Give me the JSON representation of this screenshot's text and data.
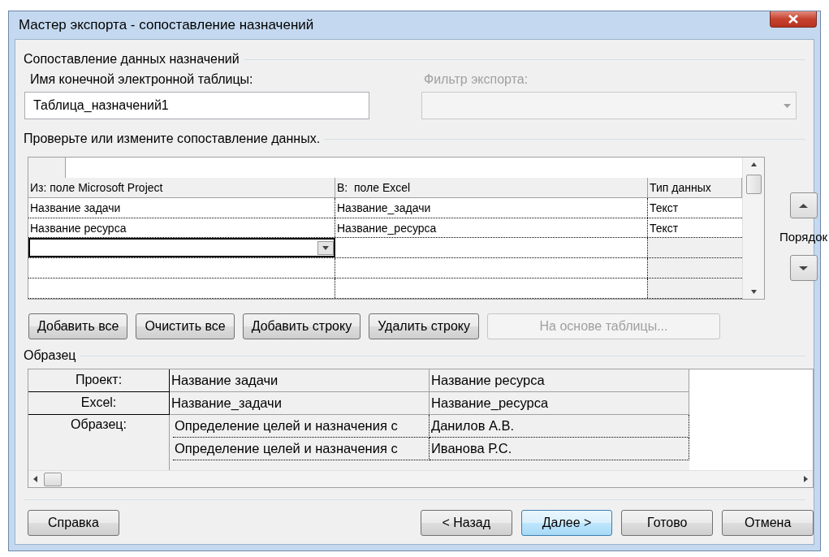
{
  "window": {
    "title": "Мастер экспорта - сопоставление назначений"
  },
  "mapping_group": {
    "title": "Сопоставление данных назначений",
    "dest_label": "Имя конечной электронной таблицы:",
    "dest_value": "Таблица_назначений1",
    "filter_label": "Фильтр экспорта:",
    "filter_disabled": true
  },
  "verify_title": "Проверьте или измените сопоставление данных.",
  "mapping_table": {
    "columns": [
      "Из: поле Microsoft Project",
      "В:  поле Excel",
      "Тип данных"
    ],
    "rows": [
      {
        "kind": "data",
        "cells": [
          "Название задачи",
          "Название_задачи",
          "Текст"
        ]
      },
      {
        "kind": "data",
        "cells": [
          "Название ресурса",
          "Название_ресурса",
          "Текст"
        ]
      },
      {
        "kind": "edit"
      },
      {
        "kind": "empty"
      },
      {
        "kind": "empty"
      }
    ]
  },
  "table_buttons": [
    {
      "label": "Добавить все",
      "disabled": false
    },
    {
      "label": "Очистить все",
      "disabled": false
    },
    {
      "label": "Добавить строку",
      "disabled": false
    },
    {
      "label": "Удалить строку",
      "disabled": false
    },
    {
      "label": "На основе таблицы...",
      "disabled": true
    }
  ],
  "order": {
    "label": "Порядок"
  },
  "sample": {
    "title": "Образец",
    "rows": [
      {
        "kind": "header",
        "header": "Проект:",
        "cells": [
          "Название задачи",
          "Название ресурса"
        ]
      },
      {
        "kind": "header",
        "header": "Excel:",
        "cells": [
          "Название_задачи",
          "Название_ресурса"
        ]
      },
      {
        "kind": "samples",
        "header": "Образец:",
        "lines": [
          [
            "Определение целей и назначения с",
            "Данилов А.В."
          ],
          [
            "Определение целей и назначения с",
            "Иванова Р.С."
          ]
        ]
      }
    ]
  },
  "footer_buttons": [
    {
      "label": "Справка",
      "default": false,
      "kind": "left"
    },
    {
      "label": "< Назад",
      "default": false,
      "kind": "right"
    },
    {
      "label": "Далее >",
      "default": true,
      "kind": "right"
    },
    {
      "label": "Готово",
      "default": false,
      "kind": "right"
    },
    {
      "label": "Отмена",
      "default": false,
      "kind": "right"
    }
  ]
}
